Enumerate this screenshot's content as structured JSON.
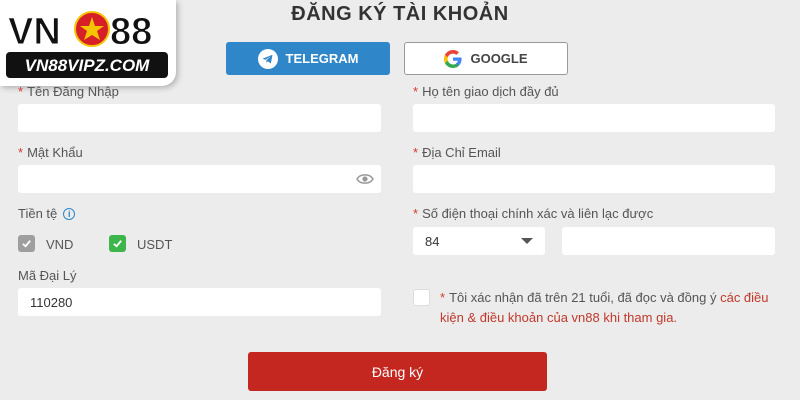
{
  "logo": {
    "brand_top": "VN88",
    "brand_bottom": "VN88VIPZ.COM"
  },
  "page_title": "ĐĂNG KÝ TÀI KHOẢN",
  "social": {
    "telegram_label": "TELEGRAM",
    "google_label": "GOOGLE"
  },
  "form": {
    "username": {
      "label": "Tên Đăng Nhập",
      "required": "*",
      "value": ""
    },
    "fullname": {
      "label": "Họ tên giao dịch đầy đủ",
      "required": "*",
      "value": ""
    },
    "password": {
      "label": "Mật Khẩu",
      "required": "*",
      "value": ""
    },
    "email": {
      "label": "Địa Chỉ Email",
      "required": "*",
      "value": ""
    },
    "currency": {
      "label": "Tiền tệ",
      "options": [
        {
          "label": "VND",
          "checked": false
        },
        {
          "label": "USDT",
          "checked": true
        }
      ]
    },
    "phone": {
      "label": "Số điện thoại chính xác và liên lạc được",
      "required": "*",
      "country_code": "84",
      "value": ""
    },
    "agent_code": {
      "label": "Mã Đại Lý",
      "value": "110280"
    },
    "terms": {
      "required": "*",
      "text": "Tôi xác nhận đã trên 21 tuổi, đã đọc và đồng ý",
      "link_text": "các điều kiện & điều khoản của vn88 khi tham gia."
    }
  },
  "submit_label": "Đăng ký",
  "colors": {
    "telegram": "#2f86c8",
    "submit": "#c4271f",
    "required": "#d23a2f",
    "check_green": "#3cb54a"
  },
  "icons": [
    "telegram-icon",
    "google-icon",
    "eye-icon",
    "info-icon",
    "check-icon",
    "chevron-down-icon"
  ]
}
